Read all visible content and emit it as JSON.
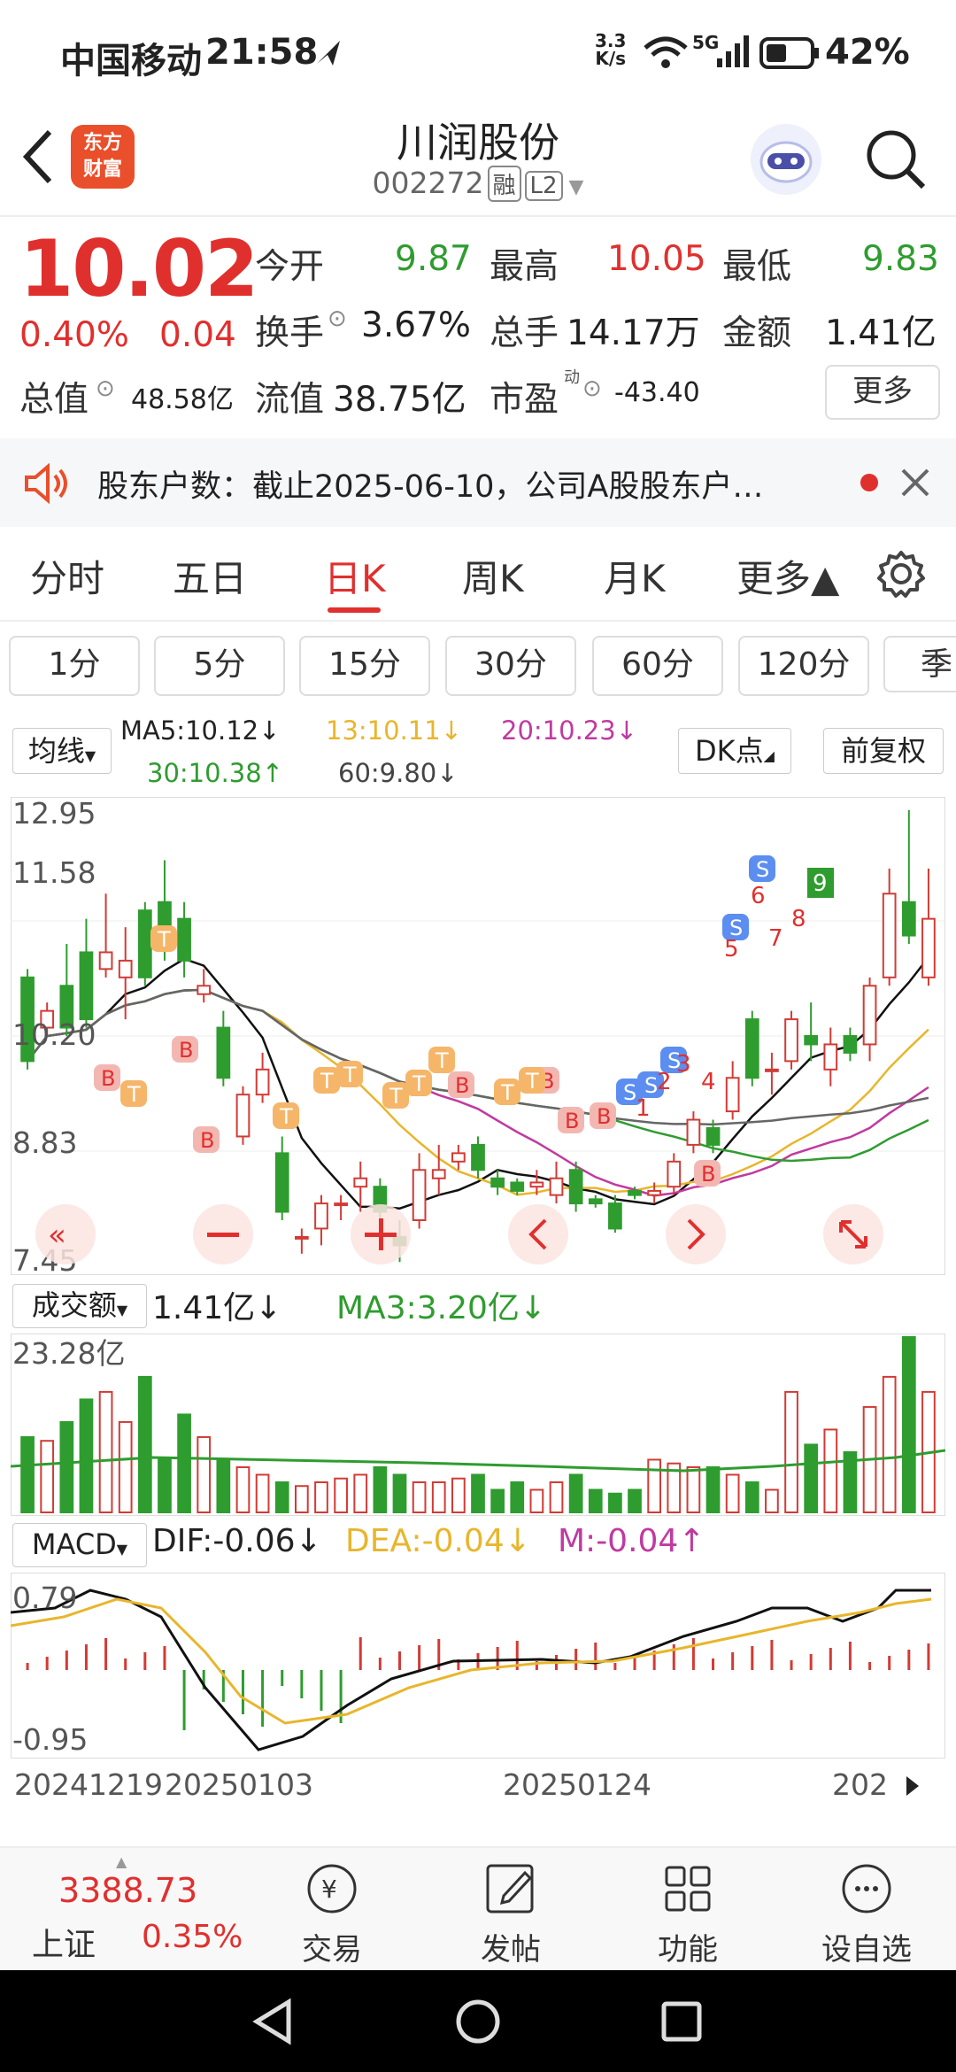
{
  "status": {
    "carrier": "中国移动",
    "time": "21:58",
    "speed_num": "3.3",
    "speed_unit": "K/s",
    "net": "5G",
    "battery": "42%"
  },
  "header": {
    "app_logo_line1": "东方",
    "app_logo_line2": "财富",
    "stock_name": "川润股份",
    "stock_code": "002272",
    "tag_margin": "融",
    "tag_level": "L2"
  },
  "quote": {
    "price": "10.02",
    "change_pct": "0.40%",
    "change": "0.04",
    "open_label": "今开",
    "open": "9.87",
    "high_label": "最高",
    "high": "10.05",
    "low_label": "最低",
    "low": "9.83",
    "turnover_label": "换手",
    "turnover": "3.67%",
    "volume_label": "总手",
    "volume": "14.17万",
    "amount_label": "金额",
    "amount": "1.41亿",
    "mktcap_label": "总值",
    "mktcap": "48.58亿",
    "float_label": "流值",
    "float_cap": "38.75亿",
    "pe_label": "市盈",
    "pe_sup": "动",
    "pe": "-43.40",
    "more": "更多"
  },
  "notice": {
    "text": "股东户数：截止2025-06-10，公司A股股东户…"
  },
  "tabs": [
    "分时",
    "五日",
    "日K",
    "周K",
    "月K",
    "更多▲"
  ],
  "periods": [
    "1分",
    "5分",
    "15分",
    "30分",
    "60分",
    "120分",
    "季"
  ],
  "ma": {
    "selector": "均线",
    "ma5": "MA5:10.12↓",
    "ma13": "13:10.11↓",
    "ma20": "20:10.23↓",
    "ma30": "30:10.38↑",
    "ma60": "60:9.80↓",
    "dk": "DK点",
    "adjust": "前复权"
  },
  "kline_axis": [
    "12.95",
    "11.58",
    "10.20",
    "8.83",
    "7.45"
  ],
  "volume": {
    "selector": "成交额",
    "value": "1.41亿↓",
    "ma3": "MA3:3.20亿↓",
    "max": "23.28亿"
  },
  "macd": {
    "selector": "MACD",
    "dif": "DIF:-0.06↓",
    "dea": "DEA:-0.04↓",
    "m": "M:-0.04↑",
    "top": "0.79",
    "bottom": "-0.95"
  },
  "dates": [
    "20241219",
    "20250103",
    "20250124",
    "202"
  ],
  "index_quote": {
    "value": "3388.73",
    "name": "上证",
    "pct": "0.35%"
  },
  "bottom_nav": [
    "交易",
    "发帖",
    "功能",
    "设自选"
  ],
  "chart_data": {
    "type": "candlestick",
    "y_range": [
      7.45,
      12.95
    ],
    "candles": [
      {
        "o": 10.9,
        "c": 9.9,
        "h": 11.0,
        "l": 9.8
      },
      {
        "o": 10.3,
        "c": 10.5,
        "h": 10.6,
        "l": 10.2
      },
      {
        "o": 10.8,
        "c": 10.3,
        "h": 11.3,
        "l": 10.2
      },
      {
        "o": 11.2,
        "c": 10.4,
        "h": 11.6,
        "l": 10.3
      },
      {
        "o": 11.0,
        "c": 11.2,
        "h": 11.9,
        "l": 10.9
      },
      {
        "o": 10.9,
        "c": 11.1,
        "h": 11.5,
        "l": 10.4
      },
      {
        "o": 11.7,
        "c": 10.9,
        "h": 11.8,
        "l": 10.8
      },
      {
        "o": 11.8,
        "c": 11.3,
        "h": 12.3,
        "l": 11.1
      },
      {
        "o": 11.6,
        "c": 11.1,
        "h": 11.8,
        "l": 10.9
      },
      {
        "o": 10.7,
        "c": 10.8,
        "h": 11.0,
        "l": 10.6
      },
      {
        "o": 10.3,
        "c": 9.7,
        "h": 10.5,
        "l": 9.6
      },
      {
        "o": 9.0,
        "c": 9.5,
        "h": 9.6,
        "l": 8.9
      },
      {
        "o": 9.5,
        "c": 9.8,
        "h": 10.0,
        "l": 9.4
      },
      {
        "o": 8.8,
        "c": 8.1,
        "h": 9.0,
        "l": 8.0
      },
      {
        "o": 7.8,
        "c": 7.8,
        "h": 7.9,
        "l": 7.6
      },
      {
        "o": 7.9,
        "c": 8.2,
        "h": 8.3,
        "l": 7.7
      },
      {
        "o": 8.2,
        "c": 8.2,
        "h": 8.3,
        "l": 8.0
      },
      {
        "o": 8.4,
        "c": 8.5,
        "h": 8.7,
        "l": 8.1
      },
      {
        "o": 8.4,
        "c": 8.1,
        "h": 8.5,
        "l": 8.0
      },
      {
        "o": 7.8,
        "c": 7.7,
        "h": 8.0,
        "l": 7.5
      },
      {
        "o": 8.0,
        "c": 8.6,
        "h": 8.8,
        "l": 7.9
      },
      {
        "o": 8.5,
        "c": 8.6,
        "h": 8.9,
        "l": 8.3
      },
      {
        "o": 8.7,
        "c": 8.8,
        "h": 8.9,
        "l": 8.6
      },
      {
        "o": 8.9,
        "c": 8.6,
        "h": 9.0,
        "l": 8.5
      },
      {
        "o": 8.5,
        "c": 8.4,
        "h": 8.6,
        "l": 8.3
      },
      {
        "o": 8.45,
        "c": 8.35,
        "h": 8.5,
        "l": 8.3
      },
      {
        "o": 8.4,
        "c": 8.45,
        "h": 8.6,
        "l": 8.3
      },
      {
        "o": 8.3,
        "c": 8.5,
        "h": 8.7,
        "l": 8.2
      },
      {
        "o": 8.6,
        "c": 8.2,
        "h": 8.7,
        "l": 8.1
      },
      {
        "o": 8.25,
        "c": 8.2,
        "h": 8.3,
        "l": 8.15
      },
      {
        "o": 8.2,
        "c": 7.9,
        "h": 8.3,
        "l": 7.85
      },
      {
        "o": 8.35,
        "c": 8.3,
        "h": 8.4,
        "l": 8.25
      },
      {
        "o": 8.3,
        "c": 8.35,
        "h": 8.45,
        "l": 8.2
      },
      {
        "o": 8.4,
        "c": 8.7,
        "h": 8.8,
        "l": 8.3
      },
      {
        "o": 8.9,
        "c": 9.2,
        "h": 9.3,
        "l": 8.8
      },
      {
        "o": 9.1,
        "c": 8.9,
        "h": 9.2,
        "l": 8.8
      },
      {
        "o": 9.3,
        "c": 9.7,
        "h": 9.9,
        "l": 9.2
      },
      {
        "o": 10.4,
        "c": 9.7,
        "h": 10.5,
        "l": 9.6
      },
      {
        "o": 9.8,
        "c": 9.8,
        "h": 10.0,
        "l": 9.5
      },
      {
        "o": 9.9,
        "c": 10.4,
        "h": 10.5,
        "l": 9.8
      },
      {
        "o": 10.2,
        "c": 10.1,
        "h": 10.6,
        "l": 9.9
      },
      {
        "o": 9.8,
        "c": 10.1,
        "h": 10.3,
        "l": 9.6
      },
      {
        "o": 10.2,
        "c": 10.0,
        "h": 10.3,
        "l": 9.9
      },
      {
        "o": 10.1,
        "c": 10.8,
        "h": 10.9,
        "l": 9.9
      },
      {
        "o": 10.9,
        "c": 11.9,
        "h": 12.2,
        "l": 10.8
      },
      {
        "o": 11.8,
        "c": 11.4,
        "h": 12.9,
        "l": 11.3
      },
      {
        "o": 10.9,
        "c": 11.6,
        "h": 12.2,
        "l": 10.8
      }
    ],
    "volume_max": 23.28,
    "volumes": [
      10,
      9.5,
      12,
      15,
      16,
      12,
      18,
      7,
      13,
      10,
      7,
      6,
      5,
      4,
      3.5,
      4,
      4.5,
      5,
      6,
      5,
      4,
      4,
      4.5,
      5,
      3,
      4,
      3,
      4,
      5,
      3,
      2.5,
      3,
      7,
      6.5,
      6,
      6,
      5,
      4,
      3,
      16,
      9,
      11,
      8,
      14,
      18,
      23.28,
      16
    ],
    "macd_range": [
      -0.95,
      0.79
    ]
  }
}
